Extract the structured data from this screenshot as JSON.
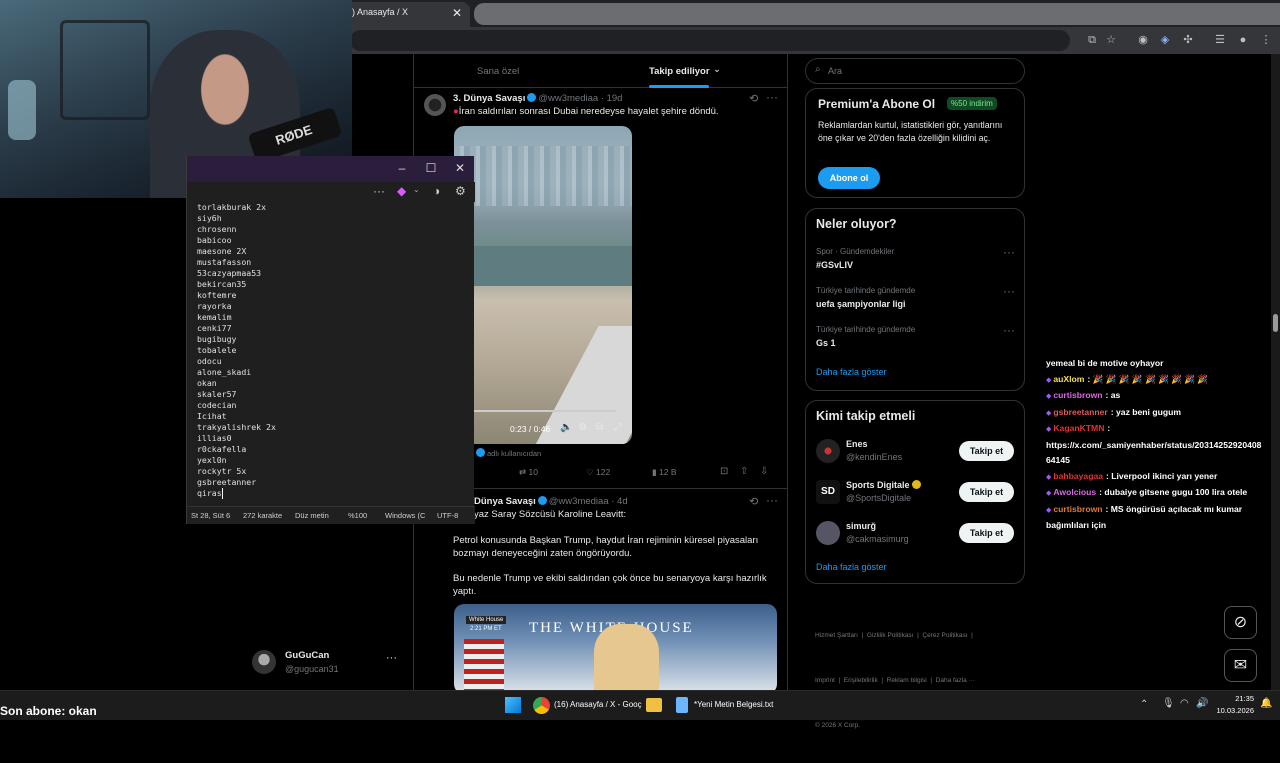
{
  "browser": {
    "tab_title": ") Anasayfa / X",
    "tab_close": "✕"
  },
  "notepad": {
    "lines": [
      "torlakburak 2x",
      "siy6h",
      "chrosenn",
      "babicoo",
      "maesone 2X",
      "mustafasson",
      "53cazyapmaa53",
      "bekircan35",
      "koftemre",
      "rayorka",
      "kemalim",
      "cenki77",
      "bugibugy",
      "tobalele",
      "odocu",
      "alone_skadi",
      "okan",
      "skaler57",
      "codecian",
      "Icihat",
      "trakyalishrek 2x",
      "illias0",
      "r0ckafella",
      "yexl0n",
      "rockytr 5x",
      "gsbreetanner",
      "qiras"
    ],
    "status": {
      "pos": "St 28, Süt 6",
      "chars": "272 karakte",
      "format": "Düz metin",
      "zoom": "%100",
      "eol": "Windows (C",
      "enc": "UTF-8"
    }
  },
  "webcam": {
    "mic_brand": "RØDE"
  },
  "x": {
    "tabs": {
      "for_you": "Sana özel",
      "following": "Takip ediliyor"
    },
    "tweet1": {
      "name": "3. Dünya Savaşı",
      "handle": "@ww3mediaa",
      "age": "· 19d",
      "text": "İran saldırıları sonrası Dubai neredeyse hayalet şehire döndü.",
      "video_time": "0:23 / 0:46",
      "source": "adlı kullanıcıdan",
      "replies": "10",
      "likes": "122",
      "views": "12 B"
    },
    "tweet2": {
      "name": "Dünya Savaşı",
      "handle": "@ww3mediaa",
      "age": "· 4d",
      "line1": "yaz Saray Sözcüsü Karoline Leavitt:",
      "para1": "Petrol konusunda Başkan Trump, haydut İran rejiminin küresel piyasaları bozmayı deneyeceğini zaten öngörüyordu.",
      "para2": "Bu nedenle Trump ve ekibi saldırıdan çok önce bu senaryoya karşı hazırlık yaptı.",
      "img_tag": "White House",
      "img_time": "2:21 PM ET",
      "img_text": "THE WHITE HOUSE"
    },
    "user": {
      "name": "GuGuCan",
      "handle": "@gugucan31"
    }
  },
  "sidebar": {
    "search_placeholder": "Ara",
    "premium": {
      "title": "Premium'a Abone Ol",
      "badge": "%50 indirim",
      "text": "Reklamlardan kurtul, istatistikleri gör, yanıtlarını öne çıkar ve 20'den fazla özelliğin kilidini aç.",
      "button": "Abone ol"
    },
    "trends": {
      "title": "Neler oluyor?",
      "items": [
        {
          "context": "Spor · Gündemdekiler",
          "name": "#GSvLIV"
        },
        {
          "context": "Türkiye tarihinde gündemde",
          "name": "uefa şampiyonlar ligi"
        },
        {
          "context": "Türkiye tarihinde gündemde",
          "name": "Gs 1"
        }
      ],
      "more": "Daha fazla göster"
    },
    "follow": {
      "title": "Kimi takip etmeli",
      "items": [
        {
          "name": "Enes",
          "handle": "@kendinEnes",
          "button": "Takip et"
        },
        {
          "name": "Sports Digitale",
          "handle": "@SportsDigitale",
          "button": "Takip et"
        },
        {
          "name": "simurğ",
          "handle": "@cakmasimurg",
          "button": "Takip et"
        }
      ],
      "more": "Daha fazla göster"
    },
    "footer": {
      "line1": "Hizmet Şartları  |  Gizlilik Politikası  |  Çerez Politikası  |",
      "line2": "Imprint  |  Erişilebilirlik  |  Reklam bilgisi  |  Daha fazla ···",
      "line3": "© 2026 X Corp."
    }
  },
  "chat": [
    {
      "user": "",
      "text": "yemeal bi de motive oyhayor",
      "color": "#ffffff"
    },
    {
      "user": "auXlom",
      "text": ": 🎉 🎉 🎉 🎉 🎉 🎉 🎉 🎉 🎉",
      "color": "#f4e04d"
    },
    {
      "user": "curtisbrown",
      "text": ": as",
      "color": "#d86ae0"
    },
    {
      "user": "gsbreetanner",
      "text": ": yaz beni gugum",
      "color": "#e05a5a"
    },
    {
      "user": "KaganKTMN",
      "text": ":",
      "color": "#e0342f"
    },
    {
      "user": "",
      "text": "https://x.com/_samiyenhaber/status/20314252920408",
      "color": "#ffffff"
    },
    {
      "user": "",
      "text": "64145",
      "color": "#ffffff"
    },
    {
      "user": "bahbayagaa",
      "text": ": Liverpool ikinci yarı yener",
      "color": "#e0342f"
    },
    {
      "user": "Awolcious",
      "text": ": dubaiye gitsene gugu 100 lira otele",
      "color": "#d86ae0"
    },
    {
      "user": "curtisbrown",
      "text": ": MS öngürüsü açılacak mı kumar",
      "color": "#e07a2f"
    },
    {
      "user": "",
      "text": "bağımlıları için",
      "color": "#ffffff"
    }
  ],
  "overlay": {
    "last_sub": "Son abone: okan"
  },
  "taskbar": {
    "app1": "(16) Anasayfa / X - Gooç",
    "app2": "*Yeni Metin Belgesi.txt, ",
    "time": "21:35",
    "date": "10.03.2026"
  },
  "colors": {
    "accent": "#1d9bf0",
    "bg": "#000000",
    "premium_badge": "#0f4a22"
  }
}
